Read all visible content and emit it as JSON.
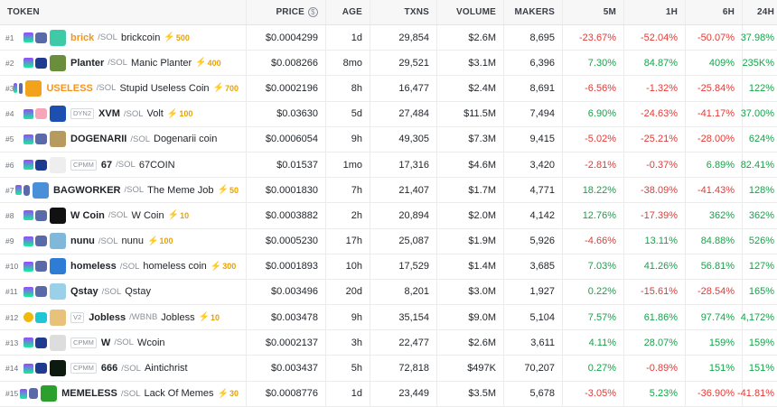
{
  "header": {
    "token": "TOKEN",
    "price": "PRICE",
    "price_icon": "$",
    "age": "AGE",
    "txns": "TXNS",
    "volume": "VOLUME",
    "makers": "MAKERS",
    "m5": "5M",
    "h1": "1H",
    "h6": "6H",
    "h24": "24H"
  },
  "colors": {
    "positive": "#16a34a",
    "negative": "#e53935",
    "boost": "#e8a300"
  },
  "rows": [
    {
      "rank": "#1",
      "chain": "sol",
      "dex": "raydium",
      "dexver": "",
      "logo": "#3ec9a7",
      "symbol": "brick",
      "symbol_orange": true,
      "quote": "/SOL",
      "name": "brickcoin",
      "boost": "500",
      "price": "$0.0004299",
      "age": "1d",
      "txns": "29,854",
      "volume": "$2.6M",
      "makers": "8,695",
      "m5": "-23.67%",
      "h1": "-52.04%",
      "h6": "-50.07%",
      "h24": "37.98%"
    },
    {
      "rank": "#2",
      "chain": "sol",
      "dex": "pump",
      "dexver": "",
      "logo": "#6b8e3d",
      "symbol": "Planter",
      "symbol_orange": false,
      "quote": "/SOL",
      "name": "Manic Planter",
      "boost": "400",
      "price": "$0.008266",
      "age": "8mo",
      "txns": "29,521",
      "volume": "$3.1M",
      "makers": "6,396",
      "m5": "7.30%",
      "h1": "84.87%",
      "h6": "409%",
      "h24": "235K%"
    },
    {
      "rank": "#3",
      "chain": "sol",
      "dex": "raydium",
      "dexver": "",
      "logo": "#f2a21b",
      "symbol": "USELESS",
      "symbol_orange": true,
      "quote": "/SOL",
      "name": "Stupid Useless Coin",
      "boost": "700",
      "price": "$0.0002196",
      "age": "8h",
      "txns": "16,477",
      "volume": "$2.4M",
      "makers": "8,691",
      "m5": "-6.56%",
      "h1": "-1.32%",
      "h6": "-25.84%",
      "h24": "122%"
    },
    {
      "rank": "#4",
      "chain": "sol",
      "dex": "orca",
      "dexver": "DYN2",
      "logo": "#1d4fb0",
      "symbol": "XVM",
      "symbol_orange": false,
      "quote": "/SOL",
      "name": "Volt",
      "boost": "100",
      "price": "$0.03630",
      "age": "5d",
      "txns": "27,484",
      "volume": "$11.5M",
      "makers": "7,494",
      "m5": "6.90%",
      "h1": "-24.63%",
      "h6": "-41.17%",
      "h24": "37.00%"
    },
    {
      "rank": "#5",
      "chain": "sol",
      "dex": "raydium",
      "dexver": "",
      "logo": "#b79a5e",
      "symbol": "DOGENARII",
      "symbol_orange": false,
      "quote": "/SOL",
      "name": "Dogenarii coin",
      "boost": "",
      "price": "$0.0006054",
      "age": "9h",
      "txns": "49,305",
      "volume": "$7.3M",
      "makers": "9,415",
      "m5": "-5.02%",
      "h1": "-25.21%",
      "h6": "-28.00%",
      "h24": "624%"
    },
    {
      "rank": "#6",
      "chain": "sol",
      "dex": "pump",
      "dexver": "CPMM",
      "logo": "#eeeeee",
      "symbol": "67",
      "symbol_orange": false,
      "quote": "/SOL",
      "name": "67COIN",
      "boost": "",
      "price": "$0.01537",
      "age": "1mo",
      "txns": "17,316",
      "volume": "$4.6M",
      "makers": "3,420",
      "m5": "-2.81%",
      "h1": "-0.37%",
      "h6": "6.89%",
      "h24": "82.41%"
    },
    {
      "rank": "#7",
      "chain": "sol",
      "dex": "raydium",
      "dexver": "",
      "logo": "#4a90d9",
      "symbol": "BAGWORKER",
      "symbol_orange": false,
      "quote": "/SOL",
      "name": "The Meme Job",
      "boost": "50",
      "price": "$0.0001830",
      "age": "7h",
      "txns": "21,407",
      "volume": "$1.7M",
      "makers": "4,771",
      "m5": "18.22%",
      "h1": "-38.09%",
      "h6": "-41.43%",
      "h24": "128%"
    },
    {
      "rank": "#8",
      "chain": "sol",
      "dex": "raydium",
      "dexver": "",
      "logo": "#111111",
      "symbol": "W Coin",
      "symbol_orange": false,
      "quote": "/SOL",
      "name": "W Coin",
      "boost": "10",
      "price": "$0.0003882",
      "age": "2h",
      "txns": "20,894",
      "volume": "$2.0M",
      "makers": "4,142",
      "m5": "12.76%",
      "h1": "-17.39%",
      "h6": "362%",
      "h24": "362%"
    },
    {
      "rank": "#9",
      "chain": "sol",
      "dex": "raydium",
      "dexver": "",
      "logo": "#7fb8d8",
      "symbol": "nunu",
      "symbol_orange": false,
      "quote": "/SOL",
      "name": "nunu",
      "boost": "100",
      "price": "$0.0005230",
      "age": "17h",
      "txns": "25,087",
      "volume": "$1.9M",
      "makers": "5,926",
      "m5": "-4.66%",
      "h1": "13.11%",
      "h6": "84.88%",
      "h24": "526%"
    },
    {
      "rank": "#10",
      "chain": "sol",
      "dex": "raydium",
      "dexver": "",
      "logo": "#2e7cd6",
      "symbol": "homeless",
      "symbol_orange": false,
      "quote": "/SOL",
      "name": "homeless coin",
      "boost": "300",
      "price": "$0.0001893",
      "age": "10h",
      "txns": "17,529",
      "volume": "$1.4M",
      "makers": "3,685",
      "m5": "7.03%",
      "h1": "41.26%",
      "h6": "56.81%",
      "h24": "127%"
    },
    {
      "rank": "#11",
      "chain": "sol",
      "dex": "raydium",
      "dexver": "",
      "logo": "#9ad0e8",
      "symbol": "Qstay",
      "symbol_orange": false,
      "quote": "/SOL",
      "name": "Qstay",
      "boost": "",
      "price": "$0.003496",
      "age": "20d",
      "txns": "8,201",
      "volume": "$3.0M",
      "makers": "1,927",
      "m5": "0.22%",
      "h1": "-15.61%",
      "h6": "-28.54%",
      "h24": "165%"
    },
    {
      "rank": "#12",
      "chain": "bnb",
      "dex": "pancake",
      "dexver": "V2",
      "logo": "#e8c27a",
      "symbol": "Jobless",
      "symbol_orange": false,
      "quote": "/WBNB",
      "name": "Jobless",
      "boost": "10",
      "price": "$0.003478",
      "age": "9h",
      "txns": "35,154",
      "volume": "$9.0M",
      "makers": "5,104",
      "m5": "7.57%",
      "h1": "61.86%",
      "h6": "97.74%",
      "h24": "4,172%"
    },
    {
      "rank": "#13",
      "chain": "sol",
      "dex": "pump",
      "dexver": "CPMM",
      "logo": "#dddddd",
      "symbol": "W",
      "symbol_orange": false,
      "quote": "/SOL",
      "name": "Wcoin",
      "boost": "",
      "price": "$0.0002137",
      "age": "3h",
      "txns": "22,477",
      "volume": "$2.6M",
      "makers": "3,611",
      "m5": "4.11%",
      "h1": "28.07%",
      "h6": "159%",
      "h24": "159%"
    },
    {
      "rank": "#14",
      "chain": "sol",
      "dex": "pump",
      "dexver": "CPMM",
      "logo": "#0d1a10",
      "symbol": "666",
      "symbol_orange": false,
      "quote": "/SOL",
      "name": "Aintichrist",
      "boost": "",
      "price": "$0.003437",
      "age": "5h",
      "txns": "72,818",
      "volume": "$497K",
      "makers": "70,207",
      "m5": "0.27%",
      "h1": "-0.89%",
      "h6": "151%",
      "h24": "151%"
    },
    {
      "rank": "#15",
      "chain": "sol",
      "dex": "raydium",
      "dexver": "",
      "logo": "#2ca02c",
      "symbol": "MEMELESS",
      "symbol_orange": false,
      "quote": "/SOL",
      "name": "Lack Of Memes",
      "boost": "30",
      "price": "$0.0008776",
      "age": "1d",
      "txns": "23,449",
      "volume": "$3.5M",
      "makers": "5,678",
      "m5": "-3.05%",
      "h1": "5.23%",
      "h6": "-36.90%",
      "h24": "-41.81%"
    }
  ]
}
